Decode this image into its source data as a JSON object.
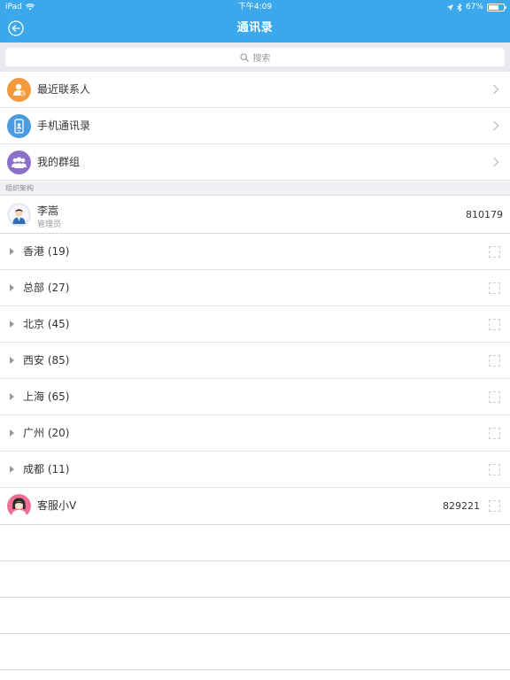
{
  "status_bar": {
    "device": "iPad",
    "time": "下午4:09",
    "battery_percent": "67%",
    "battery_level": 0.67
  },
  "nav": {
    "title": "通讯录",
    "back_icon": "back-circle-icon"
  },
  "search": {
    "placeholder": "搜索"
  },
  "shortcuts": [
    {
      "label": "最近联系人",
      "icon": "recent-contact-icon",
      "color": "#f39a3c"
    },
    {
      "label": "手机通讯录",
      "icon": "phone-contacts-icon",
      "color": "#4a9be0"
    },
    {
      "label": "我的群组",
      "icon": "group-icon",
      "color": "#8b6fc9"
    }
  ],
  "section": {
    "title": "组织架构"
  },
  "manager": {
    "name": "李嵩",
    "role": "管理员",
    "number": "810179"
  },
  "groups": [
    {
      "label": "香港 (19)"
    },
    {
      "label": "总部 (27)"
    },
    {
      "label": "北京 (45)"
    },
    {
      "label": "西安 (85)"
    },
    {
      "label": "上海 (65)"
    },
    {
      "label": "广州 (20)"
    },
    {
      "label": "成都 (11)"
    }
  ],
  "service": {
    "name": "客服小V",
    "number": "829221"
  },
  "colors": {
    "header": "#3aa8eb",
    "background": "#efeff4"
  }
}
